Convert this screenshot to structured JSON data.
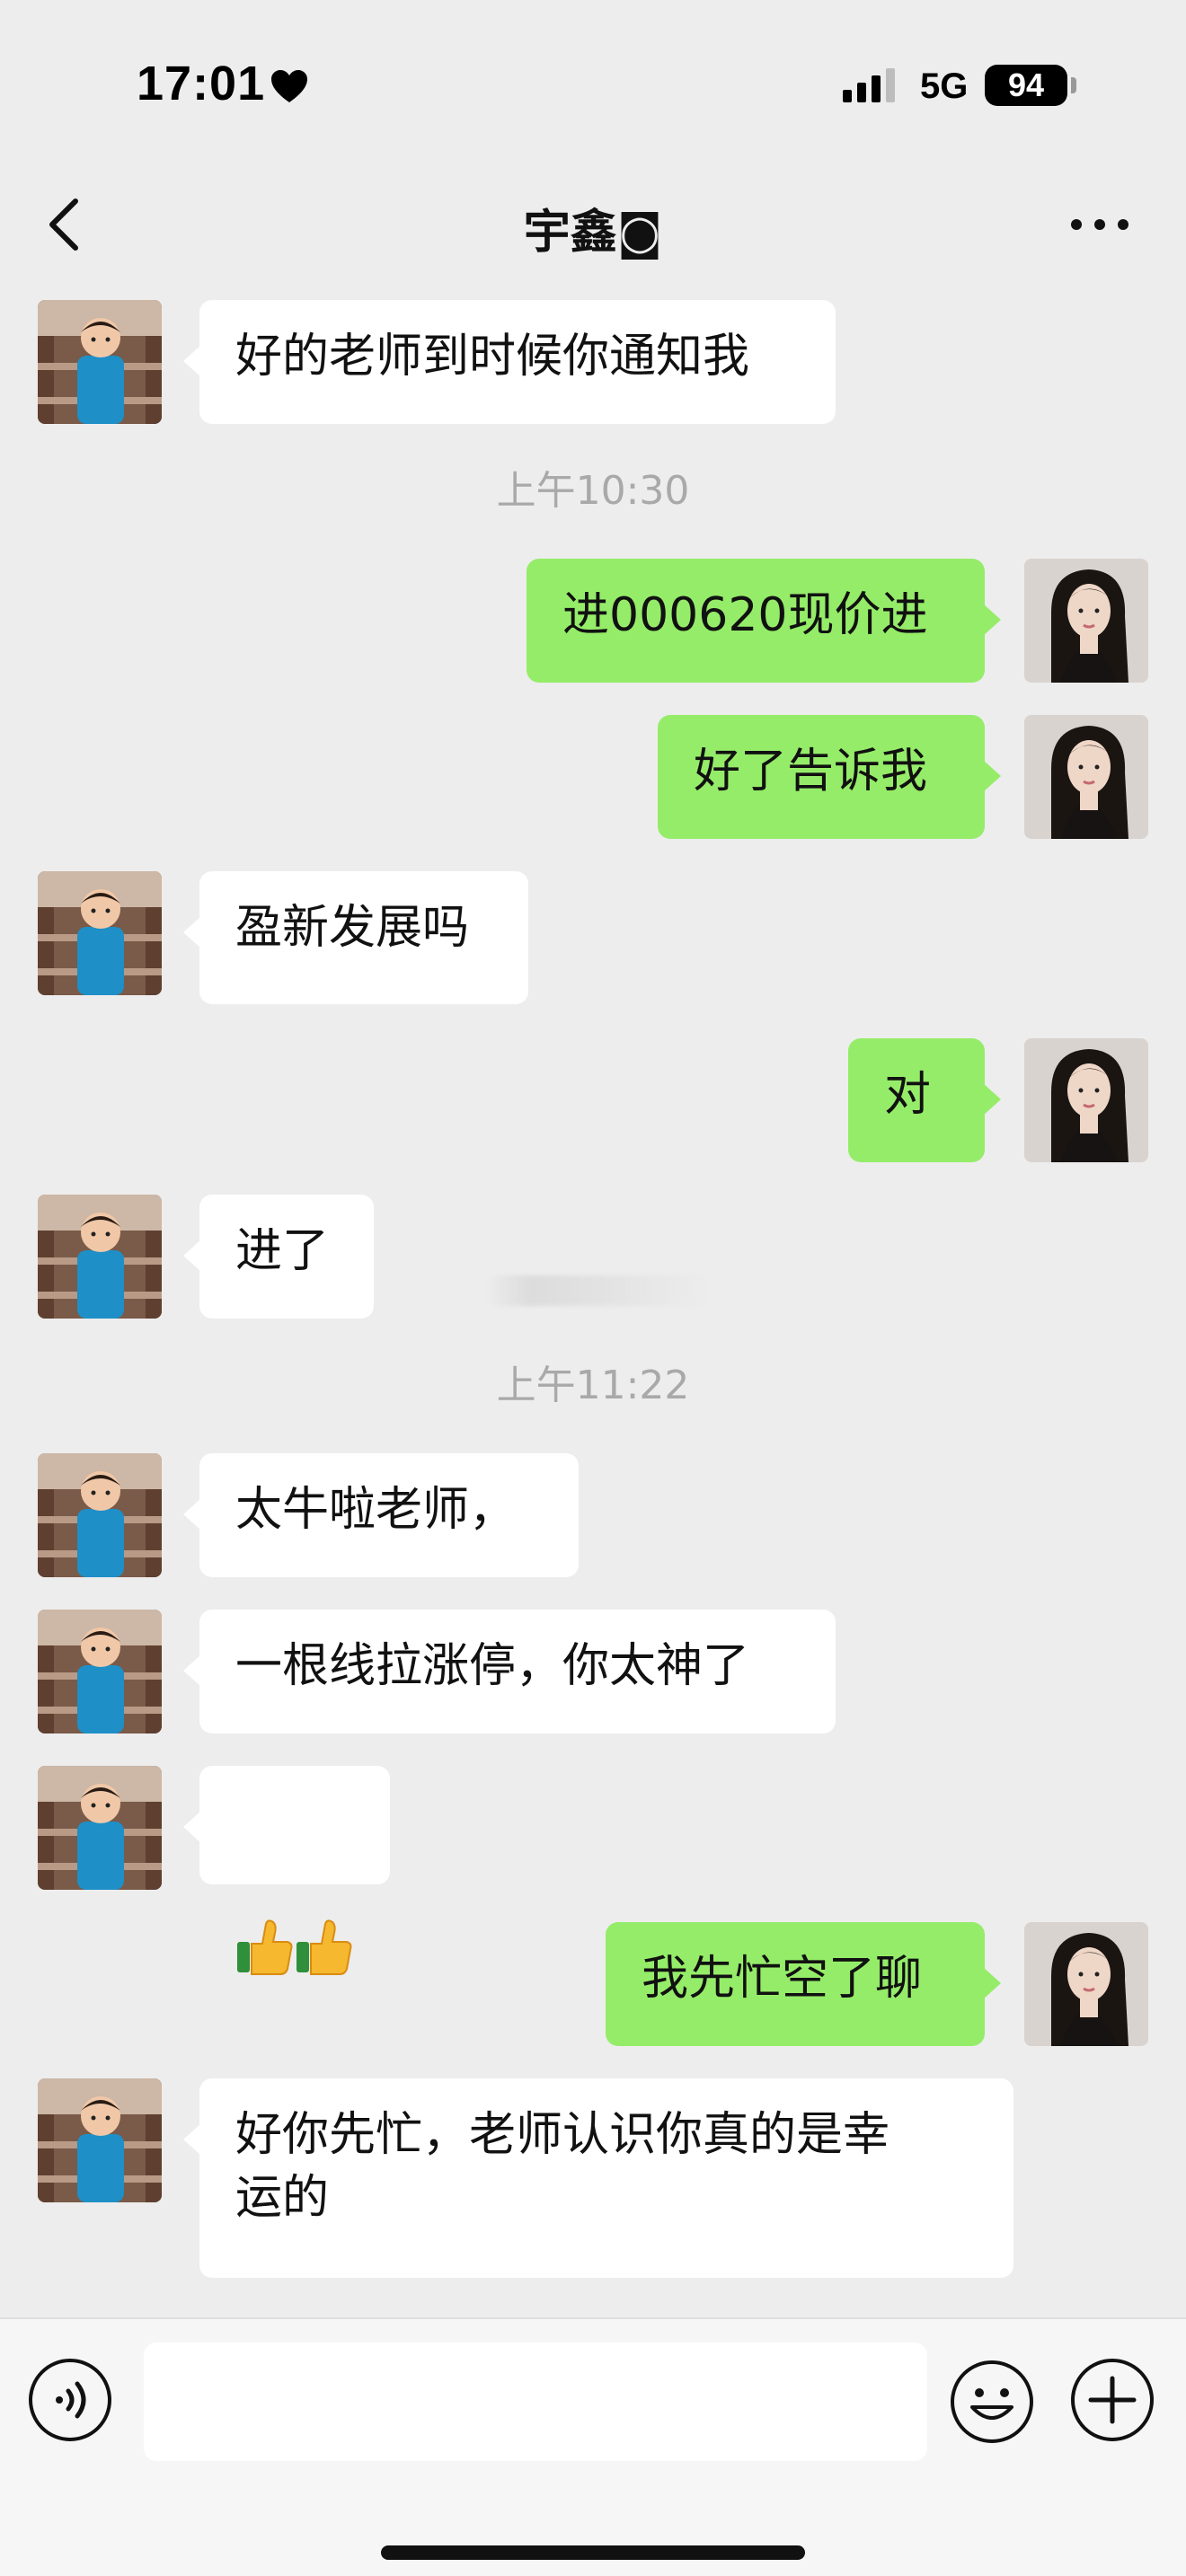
{
  "status_bar": {
    "time": "17:01",
    "network": "5G",
    "battery": "94"
  },
  "header": {
    "title": "宇鑫◙"
  },
  "messages": [
    {
      "side": "left",
      "text": "好的老师到时候你通知我"
    },
    {
      "timestamp": "上午10:30"
    },
    {
      "side": "right",
      "text": "进000620现价进"
    },
    {
      "side": "right",
      "text": "好了告诉我"
    },
    {
      "side": "left",
      "text": "盈新发展吗"
    },
    {
      "side": "right",
      "text": "对"
    },
    {
      "side": "left",
      "text": "进了"
    },
    {
      "timestamp": "上午11:22"
    },
    {
      "side": "left",
      "text": "太牛啦老师，"
    },
    {
      "side": "left",
      "text": "一根线拉涨停，你太神了"
    },
    {
      "side": "left",
      "text": "👍👍"
    },
    {
      "side": "right",
      "text": "我先忙空了聊"
    },
    {
      "side": "left",
      "text": "好你先忙，老师认识你真的是幸\n运的"
    }
  ],
  "input": {
    "placeholder": ""
  },
  "colors": {
    "background": "#ededed",
    "sent_bubble": "#95ec69",
    "received_bubble": "#ffffff",
    "timestamp_text": "#a9a9a9"
  },
  "icons": [
    "heart-icon",
    "signal-icon",
    "back-icon",
    "more-icon",
    "voice-icon",
    "emoji-icon",
    "plus-icon"
  ]
}
